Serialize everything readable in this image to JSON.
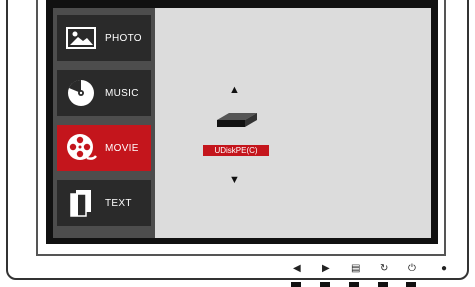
{
  "menu": {
    "items": [
      {
        "label": "PHOTO",
        "icon": "photo-icon"
      },
      {
        "label": "MUSIC",
        "icon": "music-disc-icon"
      },
      {
        "label": "MOVIE",
        "icon": "film-reel-icon",
        "selected": true
      },
      {
        "label": "TEXT",
        "icon": "document-icon"
      }
    ]
  },
  "content": {
    "drive_label": "UDiskPE(C)",
    "up_arrow": "▲",
    "down_arrow": "▼"
  },
  "controls": {
    "left": "◀",
    "right": "▶",
    "menu": "▤",
    "rotate": "↻",
    "power": "⏻",
    "led": "●"
  },
  "colors": {
    "accent": "#c4151c",
    "menu_bg": "#4d4d4d",
    "item_bg": "#2a2a2a",
    "content_bg": "#dcdcdc"
  }
}
